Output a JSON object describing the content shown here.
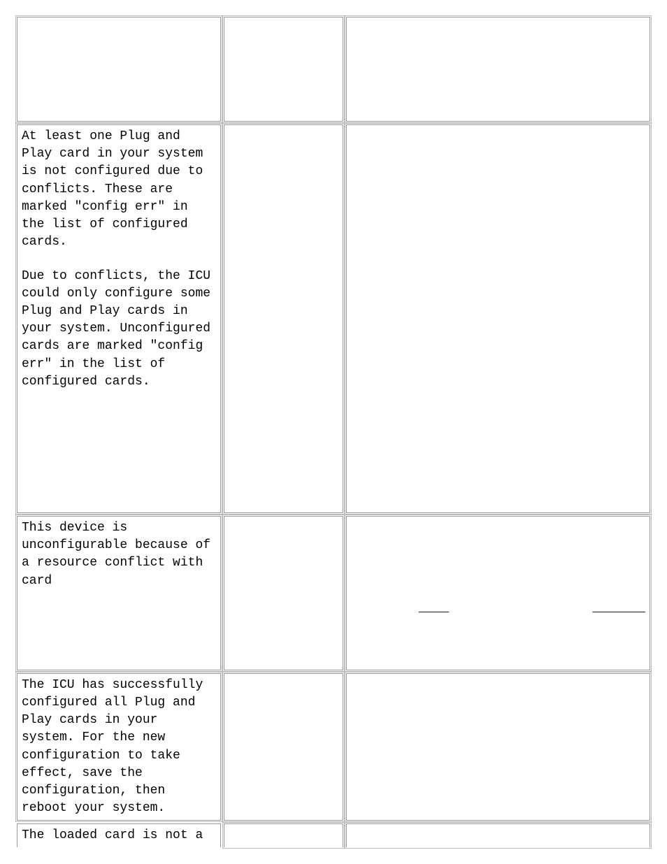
{
  "rows": [
    {
      "col1_p1": " ",
      "col1_p2": " ",
      "col2": " ",
      "col3": " "
    },
    {
      "col1_p1": "At least one Plug and Play card in your system is not configured due to conflicts. These are marked \"config err\" in the list of configured cards.",
      "col1_p2": "Due to conflicts, the ICU could only configure some Plug and Play cards in your system. Unconfigured cards are marked \"config err\" in the list of configured cards.",
      "col2": " ",
      "col3": " "
    },
    {
      "col1_p1": "This device is unconfigurable because of a resource conflict with card",
      "col1_p2": "",
      "col2": " ",
      "col3_prefix": " ",
      "col3_link1": " ",
      "col3_mid": " ",
      "col3_link2": " ",
      "col3_suffix": " "
    },
    {
      "col1_p1": "The ICU has successfully configured all Plug and Play cards in your system. For the new configuration to take effect, save the configuration, then reboot your system.",
      "col1_p2": "",
      "col2": " ",
      "col3": " "
    },
    {
      "col1_p1": "The loaded card is not a",
      "col1_p2": "",
      "col2": " ",
      "col3": " "
    }
  ]
}
